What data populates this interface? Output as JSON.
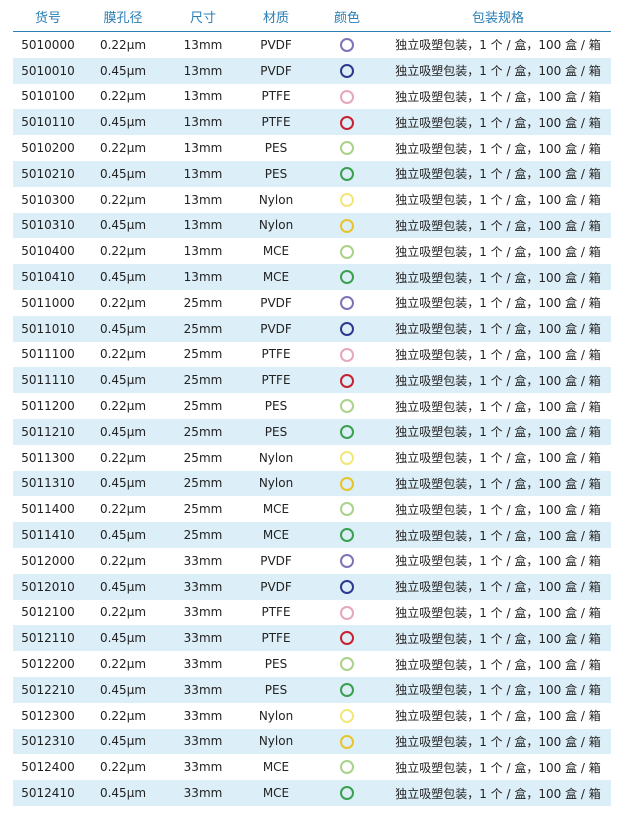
{
  "header": {
    "sku": "货号",
    "pore": "膜孔径",
    "size": "尺寸",
    "material": "材质",
    "color": "颜色",
    "packaging": "包装规格"
  },
  "colors": {
    "PVDF-0.22": "#7c74b8",
    "PVDF-0.45": "#2b3a8f",
    "PTFE-0.22": "#e6a6bd",
    "PTFE-0.45": "#c8202f",
    "PES-0.22": "#a9d28a",
    "PES-0.45": "#3aa04e",
    "Nylon-0.22": "#f3e77a",
    "Nylon-0.45": "#e8c42a",
    "MCE-0.22": "#a9d28a",
    "MCE-0.45": "#3aa04e"
  },
  "rows": [
    {
      "sku": "5010000",
      "pore": "0.22µm",
      "size": "13mm",
      "material": "PVDF",
      "color_key": "PVDF-0.22",
      "packaging": "独立吸塑包装，1 个 / 盒，100 盒 / 箱"
    },
    {
      "sku": "5010010",
      "pore": "0.45µm",
      "size": "13mm",
      "material": "PVDF",
      "color_key": "PVDF-0.45",
      "packaging": "独立吸塑包装，1 个 / 盒，100 盒 / 箱"
    },
    {
      "sku": "5010100",
      "pore": "0.22µm",
      "size": "13mm",
      "material": "PTFE",
      "color_key": "PTFE-0.22",
      "packaging": "独立吸塑包装，1 个 / 盒，100 盒 / 箱"
    },
    {
      "sku": "5010110",
      "pore": "0.45µm",
      "size": "13mm",
      "material": "PTFE",
      "color_key": "PTFE-0.45",
      "packaging": "独立吸塑包装，1 个 / 盒，100 盒 / 箱"
    },
    {
      "sku": "5010200",
      "pore": "0.22µm",
      "size": "13mm",
      "material": "PES",
      "color_key": "PES-0.22",
      "packaging": "独立吸塑包装，1 个 / 盒，100 盒 / 箱"
    },
    {
      "sku": "5010210",
      "pore": "0.45µm",
      "size": "13mm",
      "material": "PES",
      "color_key": "PES-0.45",
      "packaging": "独立吸塑包装，1 个 / 盒，100 盒 / 箱"
    },
    {
      "sku": "5010300",
      "pore": "0.22µm",
      "size": "13mm",
      "material": "Nylon",
      "color_key": "Nylon-0.22",
      "packaging": "独立吸塑包装，1 个 / 盒，100 盒 / 箱"
    },
    {
      "sku": "5010310",
      "pore": "0.45µm",
      "size": "13mm",
      "material": "Nylon",
      "color_key": "Nylon-0.45",
      "packaging": "独立吸塑包装，1 个 / 盒，100 盒 / 箱"
    },
    {
      "sku": "5010400",
      "pore": "0.22µm",
      "size": "13mm",
      "material": "MCE",
      "color_key": "MCE-0.22",
      "packaging": "独立吸塑包装，1 个 / 盒，100 盒 / 箱"
    },
    {
      "sku": "5010410",
      "pore": "0.45µm",
      "size": "13mm",
      "material": "MCE",
      "color_key": "MCE-0.45",
      "packaging": "独立吸塑包装，1 个 / 盒，100 盒 / 箱"
    },
    {
      "sku": "5011000",
      "pore": "0.22µm",
      "size": "25mm",
      "material": "PVDF",
      "color_key": "PVDF-0.22",
      "packaging": "独立吸塑包装，1 个 / 盒，100 盒 / 箱"
    },
    {
      "sku": "5011010",
      "pore": "0.45µm",
      "size": "25mm",
      "material": "PVDF",
      "color_key": "PVDF-0.45",
      "packaging": "独立吸塑包装，1 个 / 盒，100 盒 / 箱"
    },
    {
      "sku": "5011100",
      "pore": "0.22µm",
      "size": "25mm",
      "material": "PTFE",
      "color_key": "PTFE-0.22",
      "packaging": "独立吸塑包装，1 个 / 盒，100 盒 / 箱"
    },
    {
      "sku": "5011110",
      "pore": "0.45µm",
      "size": "25mm",
      "material": "PTFE",
      "color_key": "PTFE-0.45",
      "packaging": "独立吸塑包装，1 个 / 盒，100 盒 / 箱"
    },
    {
      "sku": "5011200",
      "pore": "0.22µm",
      "size": "25mm",
      "material": "PES",
      "color_key": "PES-0.22",
      "packaging": "独立吸塑包装，1 个 / 盒，100 盒 / 箱"
    },
    {
      "sku": "5011210",
      "pore": "0.45µm",
      "size": "25mm",
      "material": "PES",
      "color_key": "PES-0.45",
      "packaging": "独立吸塑包装，1 个 / 盒，100 盒 / 箱"
    },
    {
      "sku": "5011300",
      "pore": "0.22µm",
      "size": "25mm",
      "material": "Nylon",
      "color_key": "Nylon-0.22",
      "packaging": "独立吸塑包装，1 个 / 盒，100 盒 / 箱"
    },
    {
      "sku": "5011310",
      "pore": "0.45µm",
      "size": "25mm",
      "material": "Nylon",
      "color_key": "Nylon-0.45",
      "packaging": "独立吸塑包装，1 个 / 盒，100 盒 / 箱"
    },
    {
      "sku": "5011400",
      "pore": "0.22µm",
      "size": "25mm",
      "material": "MCE",
      "color_key": "MCE-0.22",
      "packaging": "独立吸塑包装，1 个 / 盒，100 盒 / 箱"
    },
    {
      "sku": "5011410",
      "pore": "0.45µm",
      "size": "25mm",
      "material": "MCE",
      "color_key": "MCE-0.45",
      "packaging": "独立吸塑包装，1 个 / 盒，100 盒 / 箱"
    },
    {
      "sku": "5012000",
      "pore": "0.22µm",
      "size": "33mm",
      "material": "PVDF",
      "color_key": "PVDF-0.22",
      "packaging": "独立吸塑包装，1 个 / 盒，100 盒 / 箱"
    },
    {
      "sku": "5012010",
      "pore": "0.45µm",
      "size": "33mm",
      "material": "PVDF",
      "color_key": "PVDF-0.45",
      "packaging": "独立吸塑包装，1 个 / 盒，100 盒 / 箱"
    },
    {
      "sku": "5012100",
      "pore": "0.22µm",
      "size": "33mm",
      "material": "PTFE",
      "color_key": "PTFE-0.22",
      "packaging": "独立吸塑包装，1 个 / 盒，100 盒 / 箱"
    },
    {
      "sku": "5012110",
      "pore": "0.45µm",
      "size": "33mm",
      "material": "PTFE",
      "color_key": "PTFE-0.45",
      "packaging": "独立吸塑包装，1 个 / 盒，100 盒 / 箱"
    },
    {
      "sku": "5012200",
      "pore": "0.22µm",
      "size": "33mm",
      "material": "PES",
      "color_key": "PES-0.22",
      "packaging": "独立吸塑包装，1 个 / 盒，100 盒 / 箱"
    },
    {
      "sku": "5012210",
      "pore": "0.45µm",
      "size": "33mm",
      "material": "PES",
      "color_key": "PES-0.45",
      "packaging": "独立吸塑包装，1 个 / 盒，100 盒 / 箱"
    },
    {
      "sku": "5012300",
      "pore": "0.22µm",
      "size": "33mm",
      "material": "Nylon",
      "color_key": "Nylon-0.22",
      "packaging": "独立吸塑包装，1 个 / 盒，100 盒 / 箱"
    },
    {
      "sku": "5012310",
      "pore": "0.45µm",
      "size": "33mm",
      "material": "Nylon",
      "color_key": "Nylon-0.45",
      "packaging": "独立吸塑包装，1 个 / 盒，100 盒 / 箱"
    },
    {
      "sku": "5012400",
      "pore": "0.22µm",
      "size": "33mm",
      "material": "MCE",
      "color_key": "MCE-0.22",
      "packaging": "独立吸塑包装，1 个 / 盒，100 盒 / 箱"
    },
    {
      "sku": "5012410",
      "pore": "0.45µm",
      "size": "33mm",
      "material": "MCE",
      "color_key": "MCE-0.45",
      "packaging": "独立吸塑包装，1 个 / 盒，100 盒 / 箱"
    }
  ]
}
